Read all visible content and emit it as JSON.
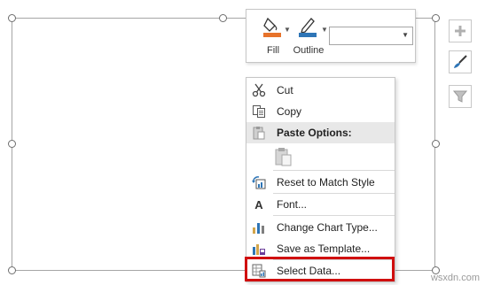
{
  "mini_toolbar": {
    "fill_label": "Fill",
    "outline_label": "Outline",
    "dropdown_value": ""
  },
  "context_menu": {
    "items": [
      {
        "label": "Cut",
        "icon": "scissors-icon"
      },
      {
        "label": "Copy",
        "icon": "copy-icon"
      },
      {
        "label": "Paste Options:",
        "icon": "paste-icon"
      },
      {
        "label": "Reset to Match Style",
        "icon": "reset-style-icon"
      },
      {
        "label": "Font...",
        "icon": "font-icon"
      },
      {
        "label": "Change Chart Type...",
        "icon": "chart-type-icon"
      },
      {
        "label": "Save as Template...",
        "icon": "template-icon"
      },
      {
        "label": "Select Data...",
        "icon": "select-data-icon"
      }
    ]
  },
  "side_buttons": [
    "chart-elements-icon",
    "chart-styles-icon",
    "chart-filters-icon"
  ],
  "watermark": "wsxdn.com",
  "colors": {
    "fill_accent": "#e7732b",
    "outline_accent": "#2e75b6",
    "highlight": "#d00f0f"
  }
}
